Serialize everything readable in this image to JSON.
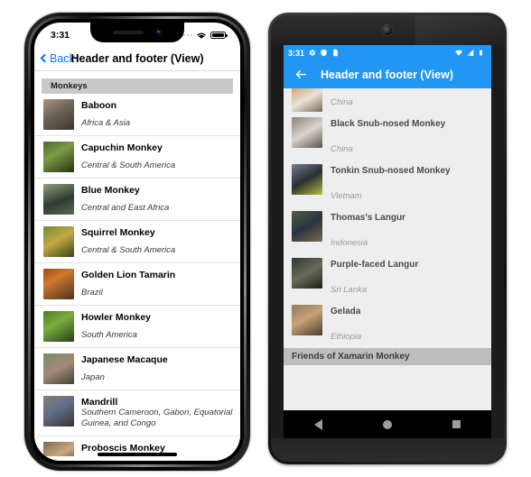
{
  "ios": {
    "status": {
      "time": "3:31",
      "wifi_icon": "wifi-icon",
      "battery_icon": "battery-icon"
    },
    "nav": {
      "back_label": "Back",
      "title": "Header and footer (View)"
    },
    "section_header": "Monkeys",
    "rows": [
      {
        "name": "Baboon",
        "location": "Africa & Asia",
        "thumb": "baboon-thumbnail"
      },
      {
        "name": "Capuchin Monkey",
        "location": "Central & South America",
        "thumb": "capuchin-monkey-thumbnail"
      },
      {
        "name": "Blue Monkey",
        "location": "Central and East Africa",
        "thumb": "blue-monkey-thumbnail"
      },
      {
        "name": "Squirrel Monkey",
        "location": "Central & South America",
        "thumb": "squirrel-monkey-thumbnail"
      },
      {
        "name": "Golden Lion Tamarin",
        "location": "Brazil",
        "thumb": "golden-lion-tamarin-thumbnail"
      },
      {
        "name": "Howler Monkey",
        "location": "South America",
        "thumb": "howler-monkey-thumbnail"
      },
      {
        "name": "Japanese Macaque",
        "location": "Japan",
        "thumb": "japanese-macaque-thumbnail"
      },
      {
        "name": "Mandrill",
        "location": "Southern Cameroon, Gabon, Equatorial Guinea, and Congo",
        "thumb": "mandrill-thumbnail"
      },
      {
        "name": "Proboscis Monkey",
        "location": "",
        "thumb": "proboscis-monkey-thumbnail"
      }
    ]
  },
  "android": {
    "status": {
      "time": "3:31",
      "icons_left": [
        "gear-icon",
        "shield-icon",
        "sd-card-icon"
      ],
      "icons_right": [
        "wifi-icon",
        "signal-icon",
        "battery-icon"
      ]
    },
    "toolbar": {
      "back_icon": "back-arrow-icon",
      "title": "Header and footer (View)"
    },
    "rows": [
      {
        "name": "",
        "location": "China",
        "thumb": "golden-snub-nosed-monkey-thumbnail"
      },
      {
        "name": "Black Snub-nosed Monkey",
        "location": "China",
        "thumb": "black-snub-nosed-monkey-thumbnail"
      },
      {
        "name": "Tonkin Snub-nosed Monkey",
        "location": "Vietnam",
        "thumb": "tonkin-snub-nosed-monkey-thumbnail"
      },
      {
        "name": "Thomas's Langur",
        "location": "Indonesia",
        "thumb": "thomas-langur-thumbnail"
      },
      {
        "name": "Purple-faced Langur",
        "location": "Sri Lanka",
        "thumb": "purple-faced-langur-thumbnail"
      },
      {
        "name": "Gelada",
        "location": "Ethiopia",
        "thumb": "gelada-thumbnail"
      }
    ],
    "footer": "Friends of Xamarin Monkey",
    "navbar": {
      "back": "nav-back-icon",
      "home": "nav-home-icon",
      "recents": "nav-recents-icon"
    }
  },
  "colors": {
    "ios_accent": "#007AFF",
    "android_primary": "#2196F3",
    "section_header_bg": "#C9C9C9",
    "android_list_bg": "#EEEEEE",
    "android_footer_bg": "#BDBDBD"
  }
}
